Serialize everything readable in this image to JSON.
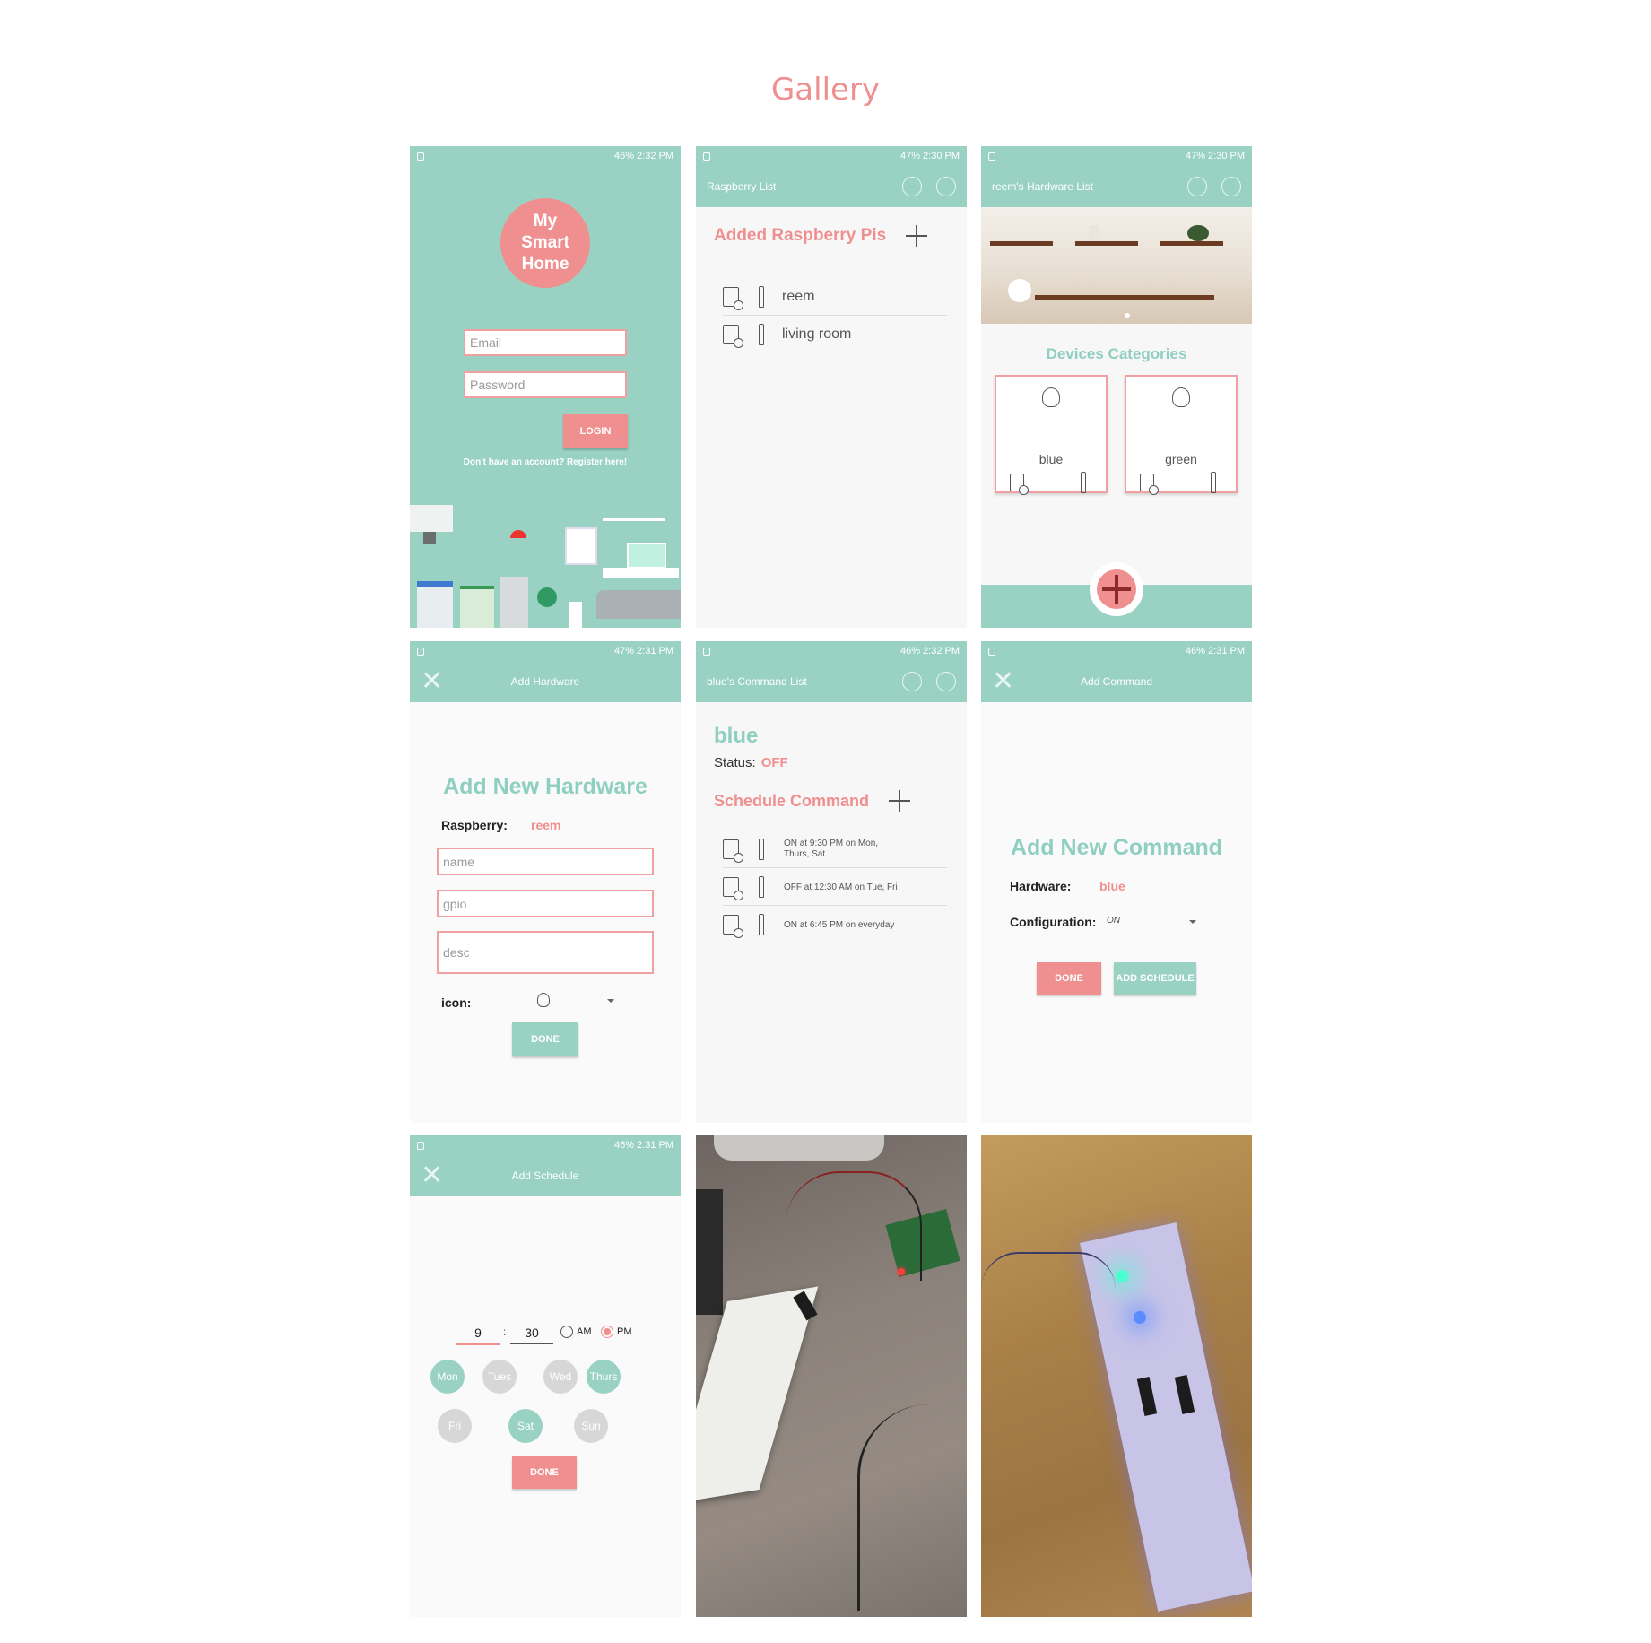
{
  "gallery_title": "Gallery",
  "colors": {
    "teal": "#99d2c3",
    "pink": "#f08f8f",
    "background": "#ffffff"
  },
  "status_bars": {
    "s1": "46% 2:32 PM",
    "s2": "47% 2:30 PM",
    "s3": "47% 2:30 PM",
    "s4": "47% 2:31 PM",
    "s5": "46% 2:32 PM",
    "s6": "46% 2:31 PM",
    "s7": "46% 2:31 PM"
  },
  "login": {
    "logo_line1": "My",
    "logo_line2": "Smart",
    "logo_line3": "Home",
    "email_placeholder": "Email",
    "password_placeholder": "Password",
    "login_button": "LOGIN",
    "register_link": "Don't have an account? Register here!"
  },
  "raspberry_list": {
    "toolbar_title": "Raspberry List",
    "heading": "Added Raspberry Pis",
    "items": [
      {
        "label": "reem"
      },
      {
        "label": "living room"
      }
    ]
  },
  "hardware_list": {
    "toolbar_title": "reem's Hardware List",
    "heading": "Devices Categories",
    "cards": [
      {
        "label": "blue"
      },
      {
        "label": "green"
      }
    ]
  },
  "add_hardware": {
    "toolbar_title": "Add Hardware",
    "heading": "Add New Hardware",
    "raspberry_label": "Raspberry:",
    "raspberry_value": "reem",
    "name_placeholder": "name",
    "gpio_placeholder": "gpio",
    "desc_placeholder": "desc",
    "icon_label": "icon:",
    "done_button": "DONE"
  },
  "command_list": {
    "toolbar_title": "blue's Command List",
    "device_name": "blue",
    "status_label": "Status:",
    "status_value": "OFF",
    "schedule_heading": "Schedule Command",
    "commands": [
      {
        "line1": "ON at 9:30 PM on Mon,",
        "line2": "Thurs, Sat"
      },
      {
        "line1": "OFF at 12:30 AM on Tue, Fri",
        "line2": ""
      },
      {
        "line1": "ON at 6:45 PM on everyday",
        "line2": ""
      }
    ]
  },
  "add_command": {
    "toolbar_title": "Add Command",
    "heading": "Add New Command",
    "hardware_label": "Hardware:",
    "hardware_value": "blue",
    "config_label": "Configuration:",
    "config_value": "ON",
    "done_button": "DONE",
    "add_schedule_button": "ADD SCHEDULE"
  },
  "add_schedule": {
    "toolbar_title": "Add Schedule",
    "hour": "9",
    "separator": ":",
    "minute": "30",
    "am_label": "AM",
    "pm_label": "PM",
    "selected_period": "PM",
    "days": [
      {
        "label": "Mon",
        "selected": true
      },
      {
        "label": "Tues",
        "selected": false
      },
      {
        "label": "Wed",
        "selected": false
      },
      {
        "label": "Thurs",
        "selected": true
      },
      {
        "label": "Fri",
        "selected": false
      },
      {
        "label": "Sat",
        "selected": true
      },
      {
        "label": "Sun",
        "selected": false
      }
    ],
    "done_button": "DONE"
  }
}
